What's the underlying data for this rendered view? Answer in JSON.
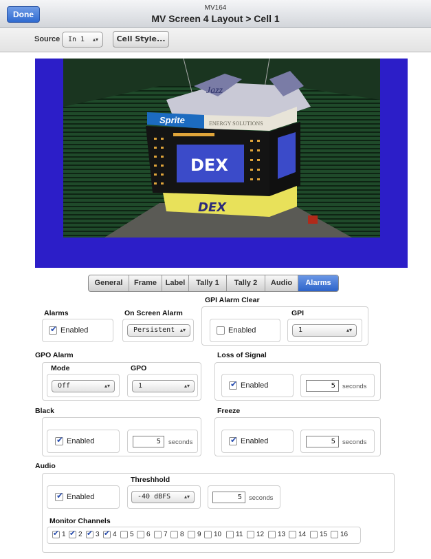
{
  "header": {
    "done_label": "Done",
    "app_name": "MV164",
    "title": "MV Screen 4 Layout > Cell 1"
  },
  "source_bar": {
    "source_label": "Source",
    "source_value": "In 1",
    "cell_style_label": "Cell Style..."
  },
  "tabs": [
    {
      "label": "General",
      "active": false
    },
    {
      "label": "Frame",
      "active": false
    },
    {
      "label": "Label",
      "active": false
    },
    {
      "label": "Tally 1",
      "active": false
    },
    {
      "label": "Tally 2",
      "active": false
    },
    {
      "label": "Audio",
      "active": false
    },
    {
      "label": "Alarms",
      "active": true
    }
  ],
  "alarms": {
    "heading": "Alarms",
    "enabled_label": "Enabled",
    "enabled": true
  },
  "on_screen_alarm": {
    "heading": "On Screen Alarm",
    "value": "Persistent"
  },
  "gpi_alarm_clear": {
    "heading": "GPI Alarm Clear",
    "enabled_label": "Enabled",
    "enabled": false,
    "gpi_label": "GPI",
    "gpi_value": "1"
  },
  "gpo_alarm": {
    "heading": "GPO Alarm",
    "mode_label": "Mode",
    "mode_value": "Off",
    "gpo_label": "GPO",
    "gpo_value": "1"
  },
  "loss_of_signal": {
    "heading": "Loss of Signal",
    "enabled_label": "Enabled",
    "enabled": true,
    "seconds": "5",
    "unit": "seconds"
  },
  "black": {
    "heading": "Black",
    "enabled_label": "Enabled",
    "enabled": true,
    "seconds": "5",
    "unit": "seconds"
  },
  "freeze": {
    "heading": "Freeze",
    "enabled_label": "Enabled",
    "enabled": true,
    "seconds": "5",
    "unit": "seconds"
  },
  "audio": {
    "heading": "Audio",
    "enabled_label": "Enabled",
    "enabled": true,
    "threshold_label": "Threshhold",
    "threshold_value": "-40 dBFS",
    "seconds": "5",
    "unit": "seconds",
    "monitor_channels_label": "Monitor Channels",
    "channels": [
      {
        "label": "1",
        "checked": true
      },
      {
        "label": "2",
        "checked": true
      },
      {
        "label": "3",
        "checked": true
      },
      {
        "label": "4",
        "checked": true
      },
      {
        "label": "5",
        "checked": false
      },
      {
        "label": "6",
        "checked": false
      },
      {
        "label": "7",
        "checked": false
      },
      {
        "label": "8",
        "checked": false
      },
      {
        "label": "9",
        "checked": false
      },
      {
        "label": "10",
        "checked": false
      },
      {
        "label": "11",
        "checked": false
      },
      {
        "label": "12",
        "checked": false
      },
      {
        "label": "13",
        "checked": false
      },
      {
        "label": "14",
        "checked": false
      },
      {
        "label": "15",
        "checked": false
      },
      {
        "label": "16",
        "checked": false
      }
    ]
  },
  "video": {
    "scoreboard_logo": "Jazz",
    "sponsor_1": "Sprite",
    "sponsor_2": "ENERGY SOLUTIONS",
    "screen_text": "DEX",
    "colors": {
      "background": "#2c1ec8",
      "accent": "#2d63c9"
    }
  }
}
